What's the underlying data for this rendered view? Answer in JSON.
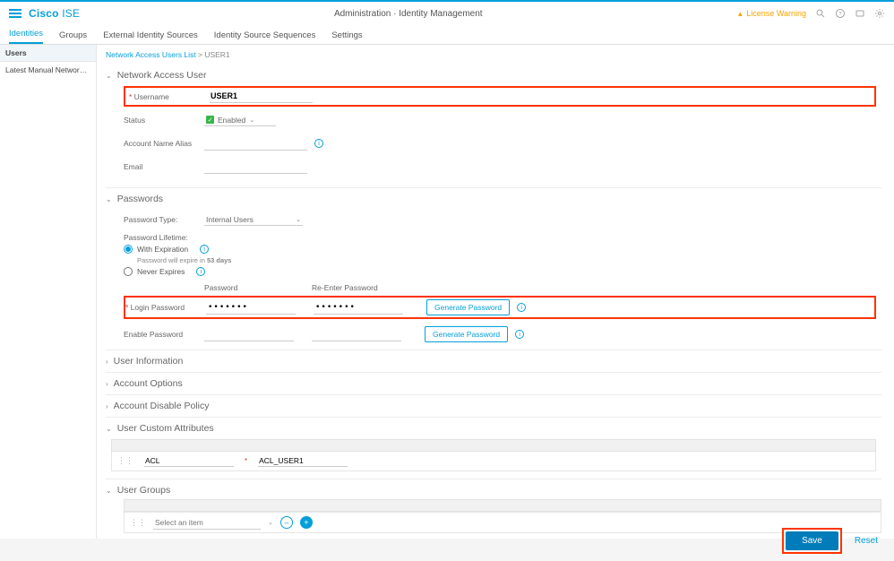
{
  "header": {
    "brand": "Cisco",
    "product": "ISE",
    "title": "Administration · Identity Management",
    "warning": "License Warning"
  },
  "tabs": [
    "Identities",
    "Groups",
    "External Identity Sources",
    "Identity Source Sequences",
    "Settings"
  ],
  "sidebar": {
    "items": [
      "Users",
      "Latest Manual Network Scan Res…"
    ]
  },
  "breadcrumb": {
    "parent": "Network Access Users List",
    "current": "USER1"
  },
  "sections": {
    "nau": {
      "title": "Network Access User",
      "username_label": "Username",
      "username": "USER1",
      "status_label": "Status",
      "status": "Enabled",
      "alias_label": "Account Name Alias",
      "alias": "",
      "email_label": "Email",
      "email": ""
    },
    "passwords": {
      "title": "Passwords",
      "type_label": "Password Type:",
      "type": "Internal Users",
      "lifetime_label": "Password Lifetime:",
      "opt_with_exp": "With Expiration",
      "exp_note_prefix": "Password will expire in ",
      "exp_days": "53 days",
      "opt_never": "Never Expires",
      "col_password": "Password",
      "col_reenter": "Re-Enter Password",
      "login_label": "Login Password",
      "login_pw": "•••••••",
      "login_pw2": "•••••••",
      "enable_label": "Enable Password",
      "gen": "Generate Password"
    },
    "user_info": "User Information",
    "acct_opts": "Account Options",
    "acct_disable": "Account Disable Policy",
    "custom": {
      "title": "User Custom Attributes",
      "attr_name": "ACL",
      "attr_value": "ACL_USER1"
    },
    "groups": {
      "title": "User Groups",
      "placeholder": "Select an item"
    }
  },
  "footer": {
    "save": "Save",
    "reset": "Reset"
  }
}
